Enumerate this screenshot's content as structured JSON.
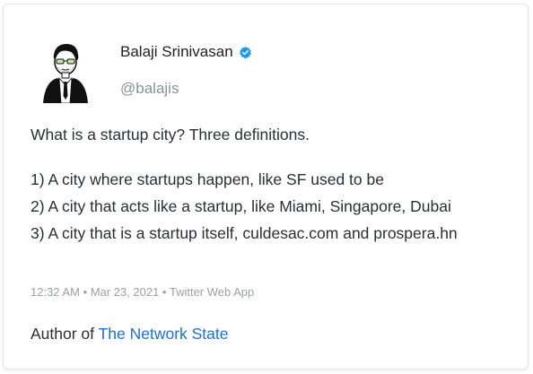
{
  "author": {
    "name": "Balaji Srinivasan",
    "handle": "@balajis",
    "verified": true,
    "avatar_icon": "avatar-illustration-icon"
  },
  "tweet": {
    "intro": "What is a startup city? Three definitions.",
    "lines": [
      "1) A city where startups happen, like SF used to be",
      "2) A city that acts like a startup, like Miami, Singapore, Dubai",
      "3) A city that is a startup itself, culdesac.com and prospera.hn"
    ],
    "meta": "12:32 AM • Mar 23, 2021 • Twitter Web App"
  },
  "footer": {
    "prefix": "Author of",
    "link_text": "The Network State"
  },
  "colors": {
    "text": "#292f33",
    "muted": "#8a9199",
    "link": "#1b6fd8",
    "verified": "#1d9bf0"
  }
}
